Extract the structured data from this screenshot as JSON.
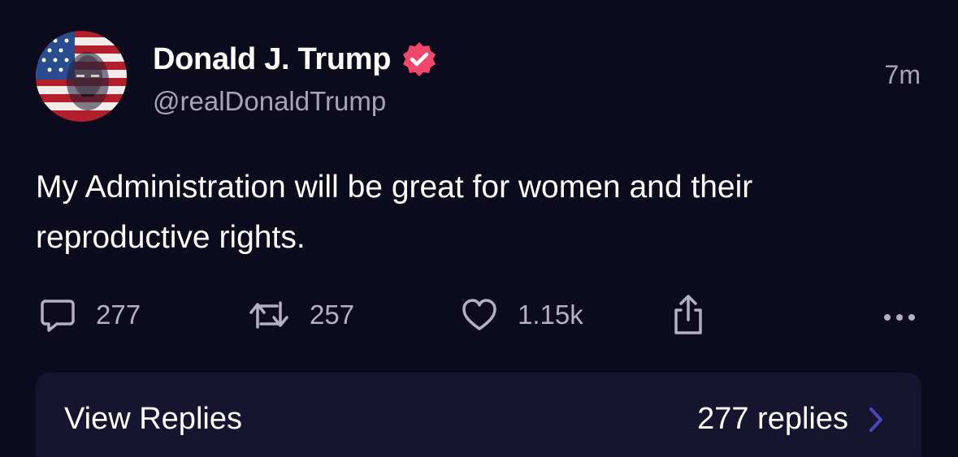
{
  "author": {
    "name": "Donald J. Trump",
    "handle": "@realDonaldTrump",
    "verified": true,
    "avatar_icon": "flag-portrait-avatar"
  },
  "post": {
    "time": "7m",
    "text": "My Administration will be great for women and their reproductive rights."
  },
  "actions": {
    "replies": "277",
    "reposts": "257",
    "likes": "1.15k",
    "icons": [
      "reply-icon",
      "repost-icon",
      "heart-icon",
      "share-icon",
      "more-icon"
    ]
  },
  "replies_bar": {
    "label": "View Replies",
    "count": "277 replies"
  },
  "colors": {
    "background": "#0c0a1d",
    "bar_background": "#17142f",
    "verified_badge": "#f0476b",
    "muted_text": "#a6a4b6",
    "chevron": "#4b46b8"
  }
}
